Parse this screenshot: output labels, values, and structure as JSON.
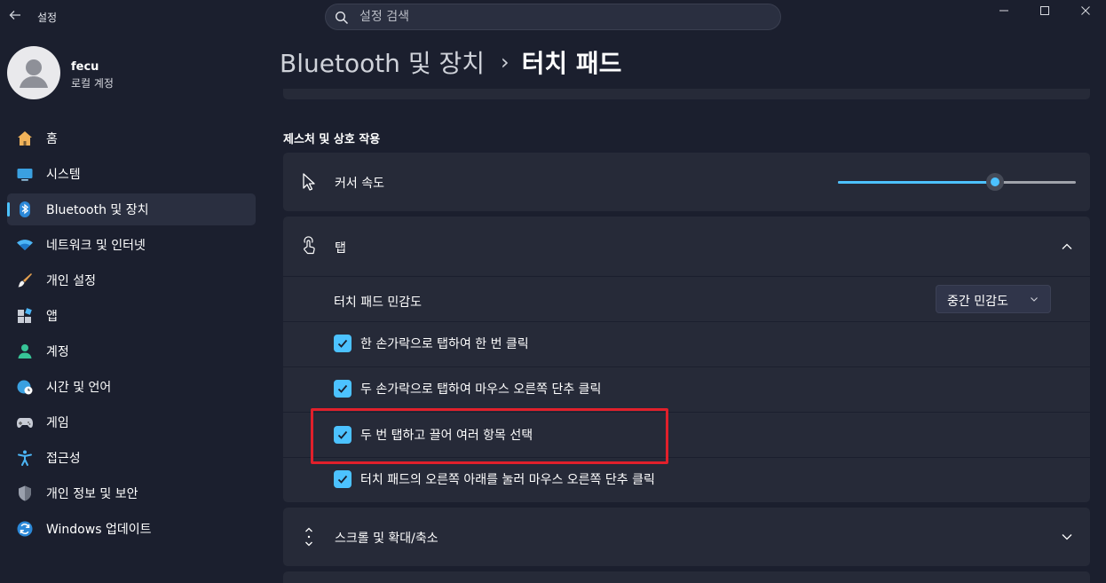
{
  "titlebar": {
    "title": "설정",
    "search_placeholder": "설정 검색"
  },
  "profile": {
    "name": "fecu",
    "account_type": "로컬 계정"
  },
  "sidebar": {
    "items": [
      {
        "label": "홈",
        "icon": "home-icon"
      },
      {
        "label": "시스템",
        "icon": "system-icon"
      },
      {
        "label": "Bluetooth 및 장치",
        "icon": "bluetooth-icon",
        "active": true
      },
      {
        "label": "네트워크 및 인터넷",
        "icon": "wifi-icon"
      },
      {
        "label": "개인 설정",
        "icon": "brush-icon"
      },
      {
        "label": "앱",
        "icon": "apps-icon"
      },
      {
        "label": "계정",
        "icon": "account-icon"
      },
      {
        "label": "시간 및 언어",
        "icon": "globe-clock-icon"
      },
      {
        "label": "게임",
        "icon": "gamepad-icon"
      },
      {
        "label": "접근성",
        "icon": "accessibility-icon"
      },
      {
        "label": "개인 정보 및 보안",
        "icon": "shield-icon"
      },
      {
        "label": "Windows 업데이트",
        "icon": "update-icon"
      }
    ]
  },
  "breadcrumb": {
    "parent": "Bluetooth 및 장치",
    "separator": "›",
    "current": "터치 패드"
  },
  "main": {
    "section_title": "제스처 및 상호 작용",
    "cursor_speed": {
      "label": "커서 속도",
      "value_fraction": 0.66
    },
    "tap": {
      "label": "탭",
      "sensitivity_label": "터치 패드 민감도",
      "sensitivity_value": "중간 민감도",
      "options": [
        {
          "label": "한 손가락으로 탭하여 한 번 클릭",
          "checked": true
        },
        {
          "label": "두 손가락으로 탭하여 마우스 오른쪽 단추 클릭",
          "checked": true
        },
        {
          "label": "두 번 탭하고 끌어 여러 항목 선택",
          "checked": true
        },
        {
          "label": "터치 패드의 오른쪽 아래를 눌러 마우스 오른쪽 단추 클릭",
          "checked": true
        }
      ]
    },
    "scroll_zoom": {
      "label": "스크롤 및 확대/축소"
    }
  },
  "colors": {
    "accent": "#4cc2ff",
    "highlight": "#e1202b",
    "card": "#262a38",
    "background": "#1b1f2e"
  }
}
